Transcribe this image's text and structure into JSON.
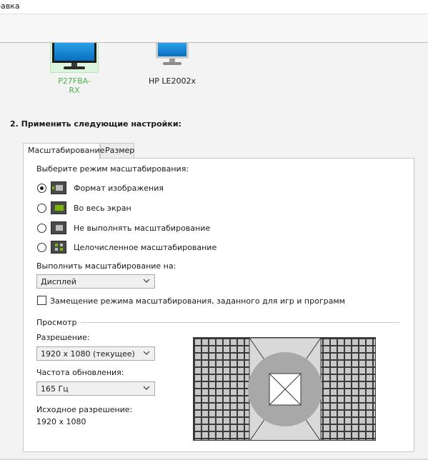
{
  "menubar": {
    "item": "равка"
  },
  "displays": [
    {
      "name": "P27FBA-RX",
      "selected": true
    },
    {
      "name": "HP LE2002x",
      "selected": false
    }
  ],
  "section": {
    "title": "2. Применить следующие настройки:"
  },
  "tabs": [
    {
      "label": "Масштабирование",
      "active": true
    },
    {
      "label": "Размер",
      "active": false
    }
  ],
  "scaling": {
    "prompt": "Выберите режим масштабирования:",
    "options": [
      {
        "label": "Формат изображения",
        "selected": true,
        "icon": "aspect-ratio-icon"
      },
      {
        "label": "Во весь экран",
        "selected": false,
        "icon": "full-screen-icon"
      },
      {
        "label": "Не выполнять масштабирование",
        "selected": false,
        "icon": "no-scaling-icon"
      },
      {
        "label": "Целочисленное масштабирование",
        "selected": false,
        "icon": "integer-scaling-icon"
      }
    ],
    "perform_on_label": "Выполнить масштабирование на:",
    "perform_on_value": "Дисплей",
    "override_label": "Замещение режима масштабирования, заданного для игр и программ",
    "override_checked": false
  },
  "preview": {
    "title": "Просмотр",
    "resolution_label": "Разрешение:",
    "resolution_value": "1920 x 1080 (текущее)",
    "refresh_label": "Частота обновления:",
    "refresh_value": "165 Гц",
    "native_label": "Исходное разрешение:",
    "native_value": "1920 x 1080"
  },
  "colors": {
    "selected_display_text": "#4cb34c",
    "selected_display_bg": "#dcf5dc",
    "icon_accent": "#76b900"
  }
}
